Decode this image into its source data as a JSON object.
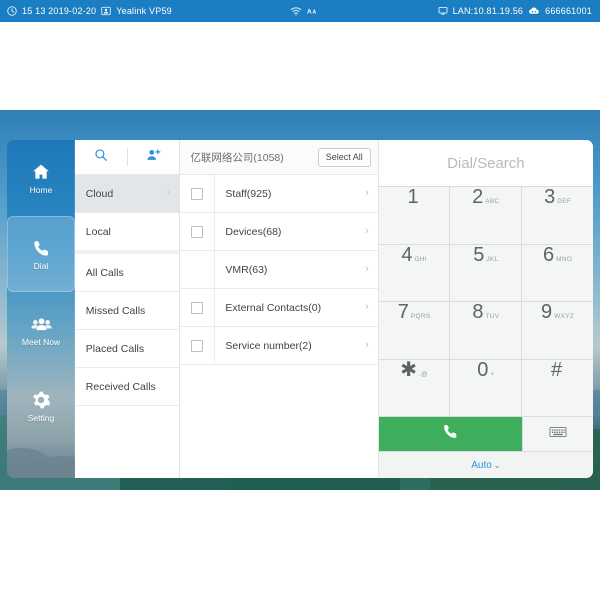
{
  "status_bar": {
    "clock_icon": "clock-icon",
    "time_date": "15 13 2019-02-20",
    "account_icon": "contact-card-icon",
    "device_name": "Yealink VP59",
    "wifi_icon": "wifi-icon",
    "font_size_icon": "font-size-icon",
    "network_icon": "lan-icon",
    "lan": "LAN:10.81.19.56",
    "cloud_icon": "cloud-account-icon",
    "account_number": "666661001",
    "bar_color": "#1b7ec3"
  },
  "sidebar": {
    "items": [
      {
        "label": "Home",
        "icon": "home-icon",
        "active": false
      },
      {
        "label": "Dial",
        "icon": "phone-icon",
        "active": true
      },
      {
        "label": "Meet Now",
        "icon": "group-icon",
        "active": false
      },
      {
        "label": "Setting",
        "icon": "gear-icon",
        "active": false
      }
    ]
  },
  "directory": {
    "toolbar": {
      "search_icon": "search-icon",
      "add_contact_icon": "add-contact-icon"
    },
    "items": [
      {
        "label": "Cloud",
        "selected": true,
        "chevron": "›"
      },
      {
        "label": "Local",
        "selected": false,
        "chevron": ""
      },
      {
        "label": "All Calls",
        "selected": false,
        "chevron": ""
      },
      {
        "label": "Missed Calls",
        "selected": false,
        "chevron": ""
      },
      {
        "label": "Placed Calls",
        "selected": false,
        "chevron": ""
      },
      {
        "label": "Received Calls",
        "selected": false,
        "chevron": ""
      }
    ]
  },
  "contacts": {
    "title": "亿联网络公司(1058)",
    "select_all_label": "Select All",
    "rows": [
      {
        "label": "Staff(925)",
        "has_checkbox": true,
        "checked": false,
        "chevron": "›"
      },
      {
        "label": "Devices(68)",
        "has_checkbox": true,
        "checked": false,
        "chevron": "›"
      },
      {
        "label": "VMR(63)",
        "has_checkbox": false,
        "checked": false,
        "chevron": "›"
      },
      {
        "label": "External Contacts(0)",
        "has_checkbox": true,
        "checked": false,
        "chevron": "›"
      },
      {
        "label": "Service number(2)",
        "has_checkbox": true,
        "checked": false,
        "chevron": "›"
      }
    ]
  },
  "dialpad": {
    "input_placeholder": "Dial/Search",
    "input_value": "",
    "keys": [
      {
        "digit": "1",
        "letters": ""
      },
      {
        "digit": "2",
        "letters": "ABC"
      },
      {
        "digit": "3",
        "letters": "DEF"
      },
      {
        "digit": "4",
        "letters": "GHI"
      },
      {
        "digit": "5",
        "letters": "JKL"
      },
      {
        "digit": "6",
        "letters": "MNO"
      },
      {
        "digit": "7",
        "letters": "PQRS"
      },
      {
        "digit": "8",
        "letters": "TUV"
      },
      {
        "digit": "9",
        "letters": "WXYZ"
      },
      {
        "digit": "✱",
        "letters": ".@"
      },
      {
        "digit": "0",
        "letters": "+"
      },
      {
        "digit": "#",
        "letters": ""
      }
    ],
    "call_icon": "phone-handset-icon",
    "keyboard_icon": "keyboard-icon",
    "mode_label": "Auto",
    "mode_caret": "⌄",
    "call_button_color": "#3fae5c",
    "accent_color": "#2f93dd"
  }
}
